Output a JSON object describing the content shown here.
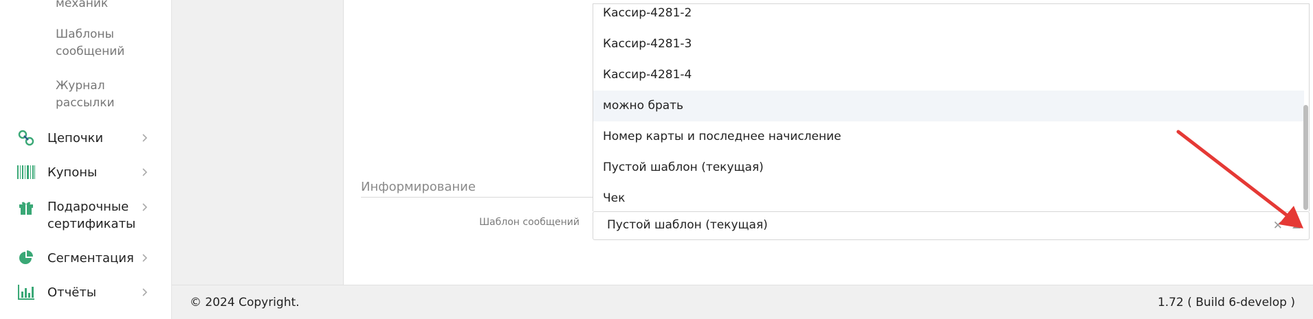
{
  "sidebar": {
    "sub_items": [
      "механик",
      "Шаблоны сообщений",
      "Журнал рассылки"
    ],
    "items": [
      {
        "label": "Цепочки",
        "icon": "link-chain-icon"
      },
      {
        "label": "Купоны",
        "icon": "barcode-icon"
      },
      {
        "label": "Подарочные сертификаты",
        "icon": "gift-icon"
      },
      {
        "label": "Сегментация",
        "icon": "pie-chart-icon"
      },
      {
        "label": "Отчёты",
        "icon": "bar-chart-icon"
      }
    ]
  },
  "form": {
    "section_title": "Информирование",
    "field_label": "Шаблон сообщений",
    "selected_value": "Пустой шаблон (текущая)",
    "clear_symbol": "✕",
    "options": [
      "Кассир-4281-2",
      "Кассир-4281-3",
      "Кассир-4281-4",
      "можно брать",
      "Номер карты и последнее начисление",
      "Пустой шаблон (текущая)",
      "Чек"
    ],
    "highlighted_option": "можно брать"
  },
  "footer": {
    "copyright": "© 2024 Copyright.",
    "version": "1.72 ( Build 6-develop )"
  },
  "colors": {
    "accent_green": "#3aa876",
    "annotation_red": "#e53935"
  }
}
